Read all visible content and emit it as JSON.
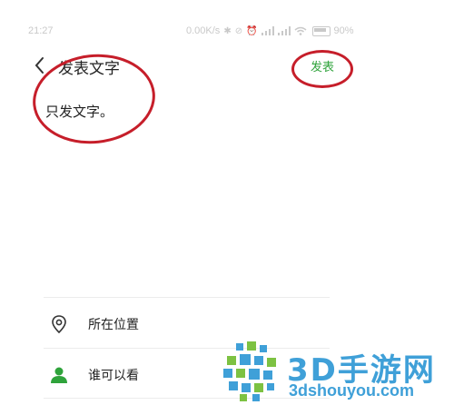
{
  "status_bar": {
    "time": "21:27",
    "network_speed": "0.00K/s",
    "battery_percent": "90%",
    "icons": [
      "bluetooth-icon",
      "mute-icon",
      "alarm-icon",
      "signal-icon",
      "signal-icon",
      "wifi-icon",
      "battery-icon"
    ]
  },
  "header": {
    "back_icon": "chevron-left-icon",
    "title": "发表文字",
    "publish_label": "发表"
  },
  "composer": {
    "text": "只发文字。"
  },
  "options": [
    {
      "icon": "location-pin-icon",
      "label": "所在位置"
    },
    {
      "icon": "person-icon",
      "label": "谁可以看"
    }
  ],
  "watermark": {
    "title": "3D手游网",
    "url": "3dshouyou.com"
  },
  "colors": {
    "accent_green": "#2fa33b",
    "annotation_red": "#c61e2a",
    "watermark_blue": "#3fa0d8",
    "watermark_green": "#7dc242"
  }
}
